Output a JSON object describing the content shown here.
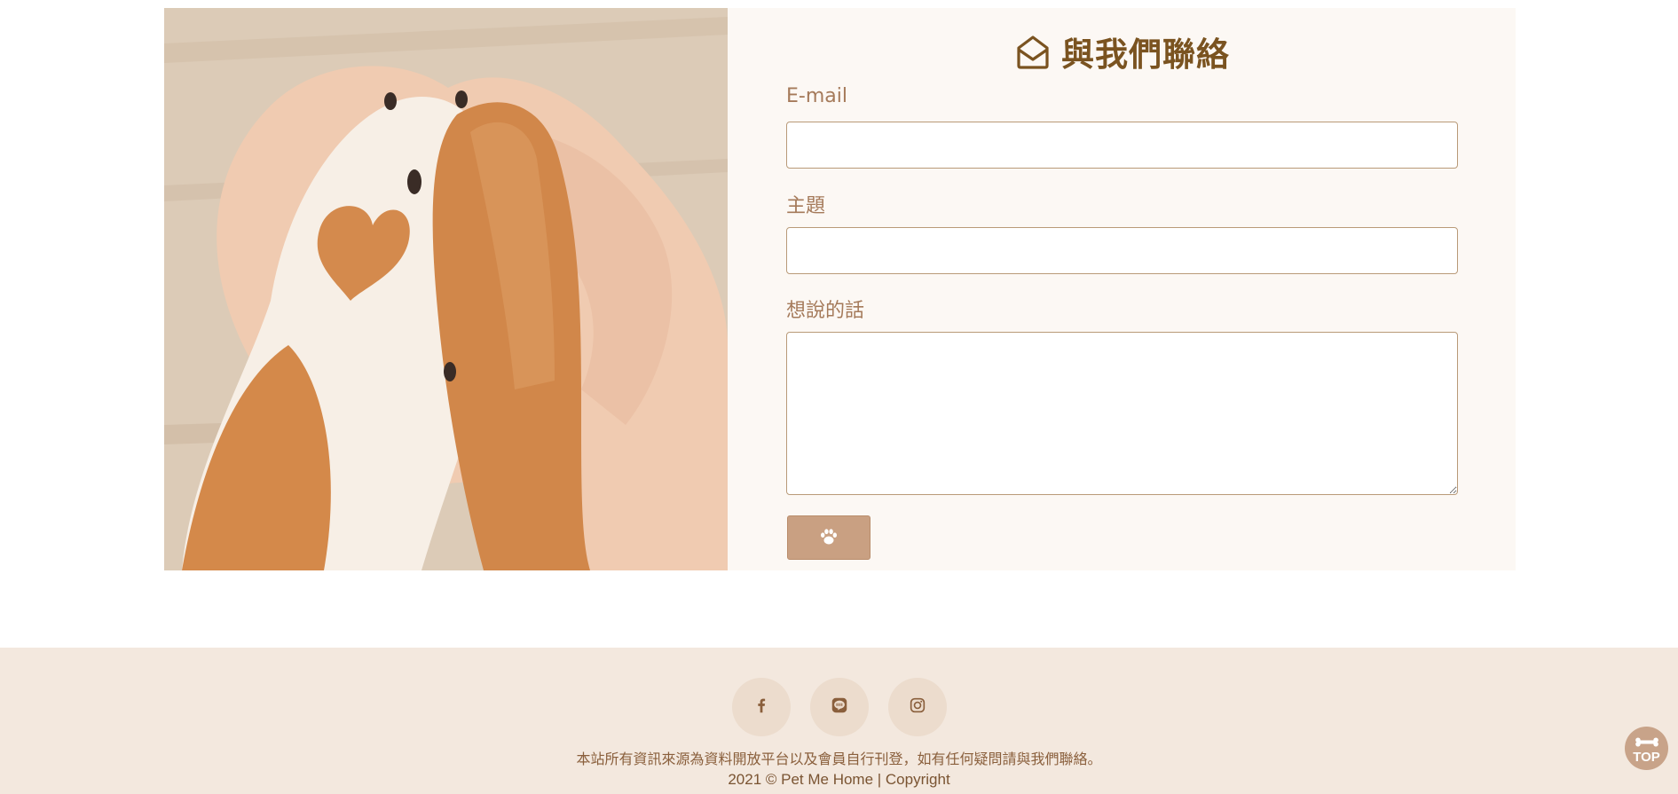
{
  "contact": {
    "title": "與我們聯絡",
    "title_icon": "envelope-open-icon",
    "photo_subject": "dog-paws-in-hands",
    "fields": [
      {
        "label": "E-mail",
        "value": "",
        "placeholder": ""
      },
      {
        "label": "主題",
        "value": "",
        "placeholder": ""
      },
      {
        "label": "想說的話",
        "value": "",
        "placeholder": ""
      }
    ],
    "submit_icon": "paw-icon"
  },
  "footer": {
    "social": [
      {
        "icon": "facebook-icon"
      },
      {
        "icon": "line-icon"
      },
      {
        "icon": "instagram-icon"
      }
    ],
    "note": "本站所有資訊來源為資料開放平台以及會員自行刊登，如有任何疑問請與我們聯絡。",
    "copyright": "2021 © Pet Me Home | Copyright"
  },
  "scroll_top": {
    "label": "TOP",
    "icon": "bone-icon"
  },
  "colors": {
    "accent_brown": "#7a5320",
    "button_tan": "#c9a082",
    "footer_bg": "#f3e8de",
    "form_bg": "#fcf8f4"
  }
}
